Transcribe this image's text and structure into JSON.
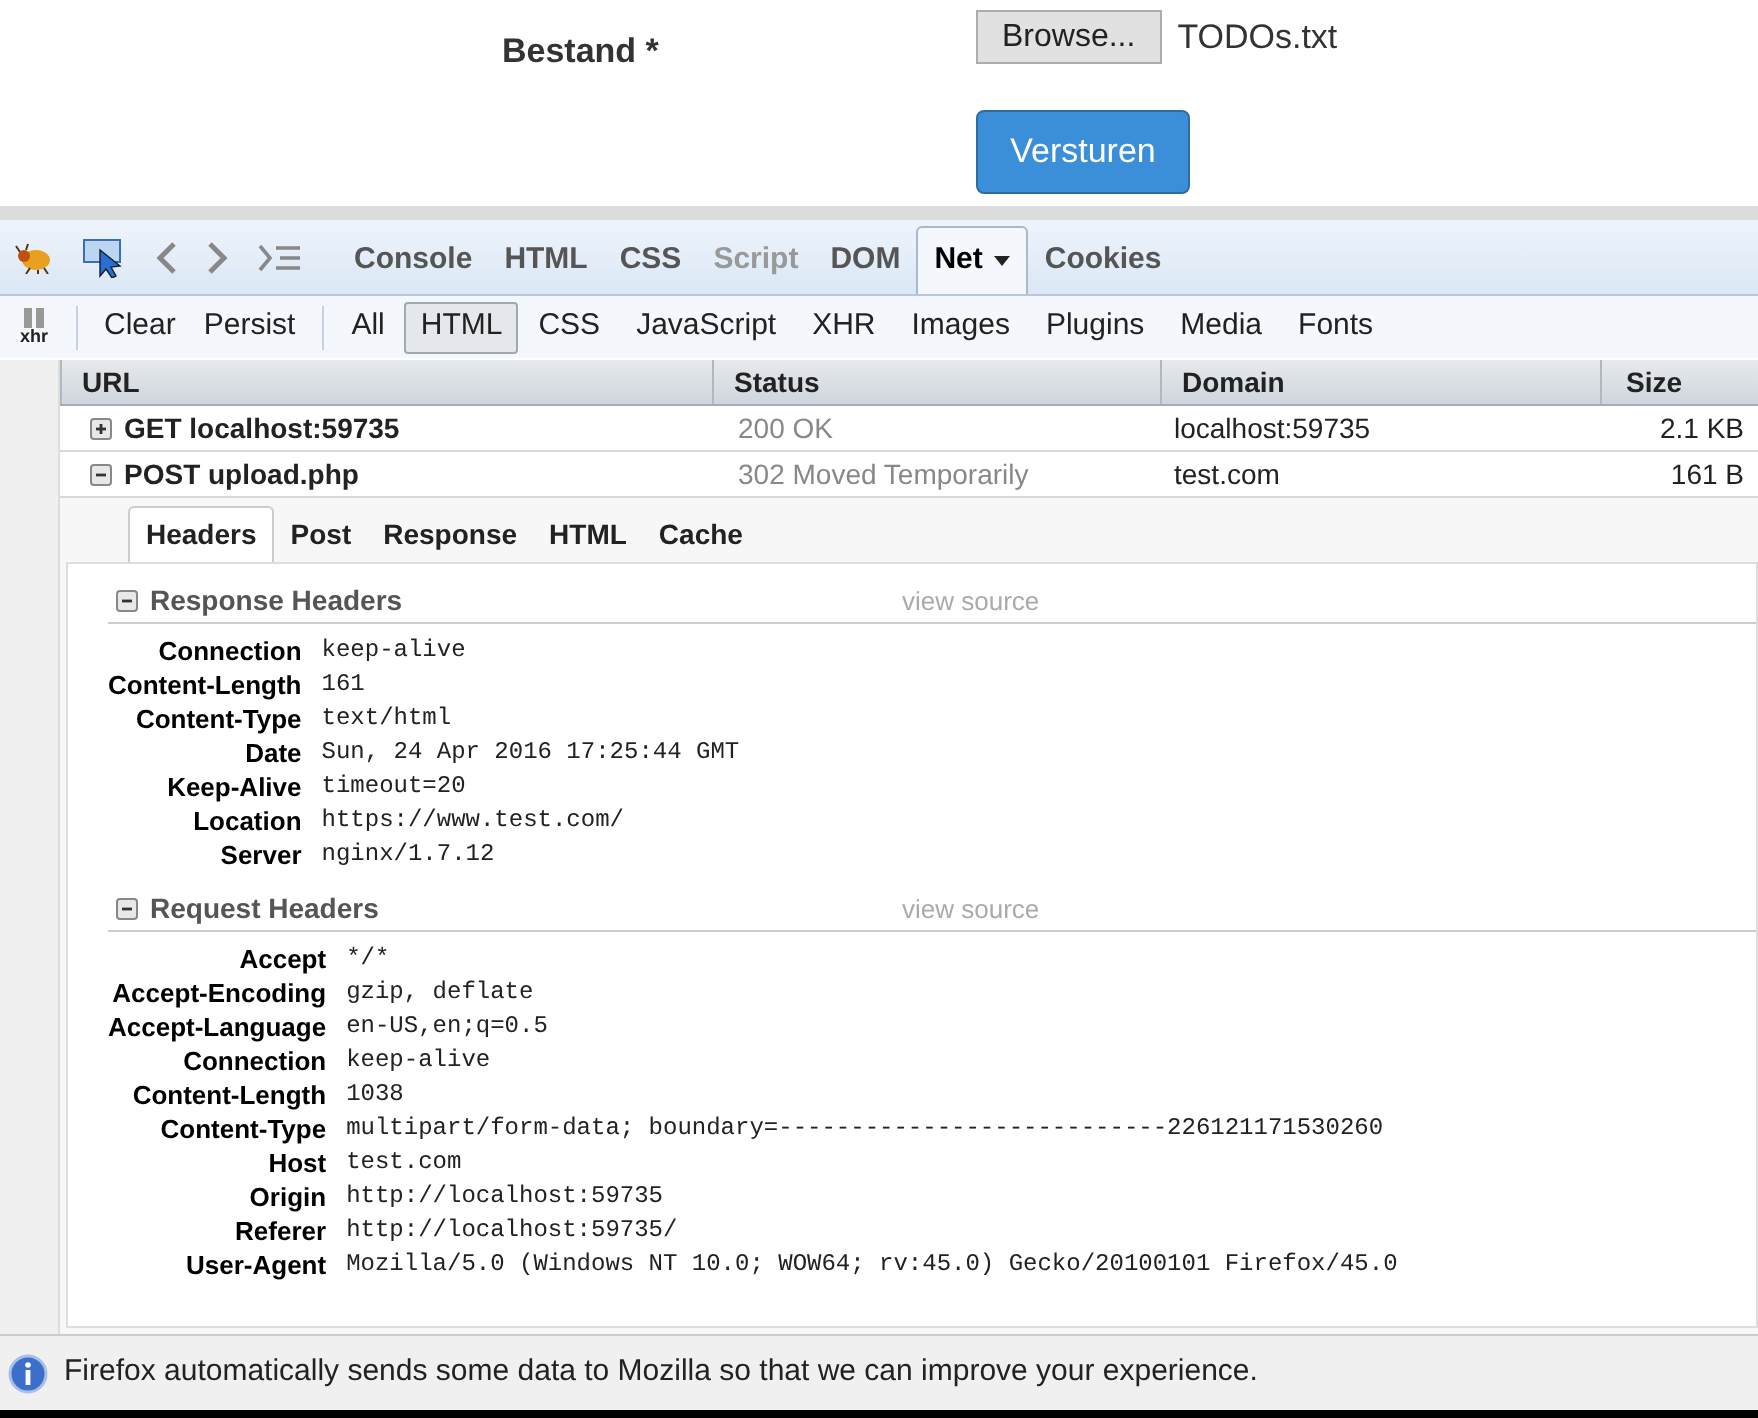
{
  "form": {
    "label": "Bestand *",
    "browse_button": "Browse...",
    "file_name": "TODOs.txt",
    "submit_button": "Versturen"
  },
  "panel_tabs": [
    {
      "label": "Console",
      "selected": false,
      "disabled": false
    },
    {
      "label": "HTML",
      "selected": false,
      "disabled": false
    },
    {
      "label": "CSS",
      "selected": false,
      "disabled": false
    },
    {
      "label": "Script",
      "selected": false,
      "disabled": true
    },
    {
      "label": "DOM",
      "selected": false,
      "disabled": false
    },
    {
      "label": "Net",
      "selected": true,
      "disabled": false,
      "dropdown": true
    },
    {
      "label": "Cookies",
      "selected": false,
      "disabled": false
    }
  ],
  "net_toolbar": {
    "xhr_label": "xhr",
    "actions": [
      "Clear",
      "Persist"
    ],
    "filters": [
      {
        "label": "All",
        "selected": false
      },
      {
        "label": "HTML",
        "selected": true
      },
      {
        "label": "CSS",
        "selected": false
      },
      {
        "label": "JavaScript",
        "selected": false
      },
      {
        "label": "XHR",
        "selected": false
      },
      {
        "label": "Images",
        "selected": false
      },
      {
        "label": "Plugins",
        "selected": false
      },
      {
        "label": "Media",
        "selected": false
      },
      {
        "label": "Fonts",
        "selected": false
      }
    ]
  },
  "table": {
    "columns": [
      "URL",
      "Status",
      "Domain",
      "Size"
    ],
    "rows": [
      {
        "url": "GET localhost:59735",
        "status": "200 OK",
        "domain": "localhost:59735",
        "size": "2.1 KB",
        "expanded": false
      },
      {
        "url": "POST upload.php",
        "status": "302 Moved Temporarily",
        "domain": "test.com",
        "size": "161 B",
        "expanded": true
      }
    ]
  },
  "detail_tabs": [
    {
      "label": "Headers",
      "selected": true
    },
    {
      "label": "Post",
      "selected": false
    },
    {
      "label": "Response",
      "selected": false
    },
    {
      "label": "HTML",
      "selected": false
    },
    {
      "label": "Cache",
      "selected": false
    }
  ],
  "sections": [
    {
      "title": "Response Headers",
      "expanded": true,
      "link": "view source",
      "headers": [
        {
          "name": "Connection",
          "value": "keep-alive"
        },
        {
          "name": "Content-Length",
          "value": "161"
        },
        {
          "name": "Content-Type",
          "value": "text/html"
        },
        {
          "name": "Date",
          "value": "Sun, 24 Apr 2016 17:25:44 GMT"
        },
        {
          "name": "Keep-Alive",
          "value": "timeout=20"
        },
        {
          "name": "Location",
          "value": "https://www.test.com/"
        },
        {
          "name": "Server",
          "value": "nginx/1.7.12"
        }
      ]
    },
    {
      "title": "Request Headers",
      "expanded": true,
      "link": "view source",
      "headers": [
        {
          "name": "Accept",
          "value": "*/*"
        },
        {
          "name": "Accept-Encoding",
          "value": "gzip, deflate"
        },
        {
          "name": "Accept-Language",
          "value": "en-US,en;q=0.5"
        },
        {
          "name": "Connection",
          "value": "keep-alive"
        },
        {
          "name": "Content-Length",
          "value": "1038"
        },
        {
          "name": "Content-Type",
          "value": "multipart/form-data; boundary=---------------------------226121171530260"
        },
        {
          "name": "Host",
          "value": "test.com"
        },
        {
          "name": "Origin",
          "value": "http://localhost:59735"
        },
        {
          "name": "Referer",
          "value": "http://localhost:59735/"
        },
        {
          "name": "User-Agent",
          "value": "Mozilla/5.0 (Windows NT 10.0; WOW64; rv:45.0) Gecko/20100101 Firefox/45.0"
        }
      ]
    }
  ],
  "notification": {
    "message": "Firefox automatically sends some data to Mozilla so that we can improve your experience."
  }
}
